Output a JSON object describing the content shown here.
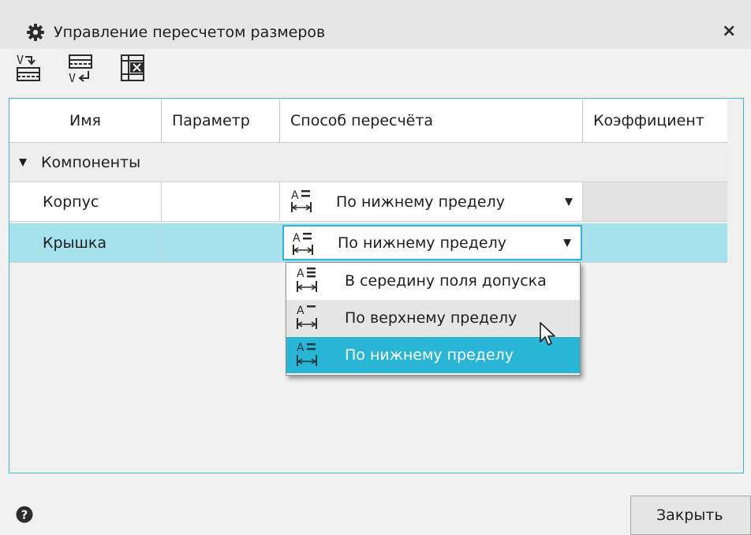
{
  "window": {
    "title": "Управление пересчетом размеров",
    "icon": "gear-icon",
    "close_icon": "close-icon"
  },
  "toolbar": {
    "buttons": [
      {
        "name": "recalc-to-table-icon"
      },
      {
        "name": "table-recalc-back-icon"
      },
      {
        "name": "table-delete-icon"
      }
    ]
  },
  "table": {
    "columns": [
      "Имя",
      "Параметр",
      "Способ пересчёта",
      "Коэффициент"
    ],
    "group": {
      "label": "Компоненты",
      "expanded": true
    },
    "rows": [
      {
        "name": "Корпус",
        "parameter": "",
        "method": "По нижнему пределу",
        "coefficient": ""
      },
      {
        "name": "Крышка",
        "parameter": "",
        "method": "По нижнему пределу",
        "coefficient": "",
        "selected": true
      }
    ]
  },
  "dropdown": {
    "options": [
      {
        "label": "В середину поля допуска",
        "icon": "tolerance-middle-icon"
      },
      {
        "label": "По верхнему пределу",
        "icon": "tolerance-upper-icon",
        "hovered": true
      },
      {
        "label": "По нижнему пределу",
        "icon": "tolerance-lower-icon",
        "selected": true
      }
    ]
  },
  "footer": {
    "help_icon": "help-icon",
    "close_label": "Закрыть"
  },
  "colors": {
    "accent": "#29b6d6",
    "selected_row": "#a6e1ee",
    "frame": "#3fb8d4"
  }
}
